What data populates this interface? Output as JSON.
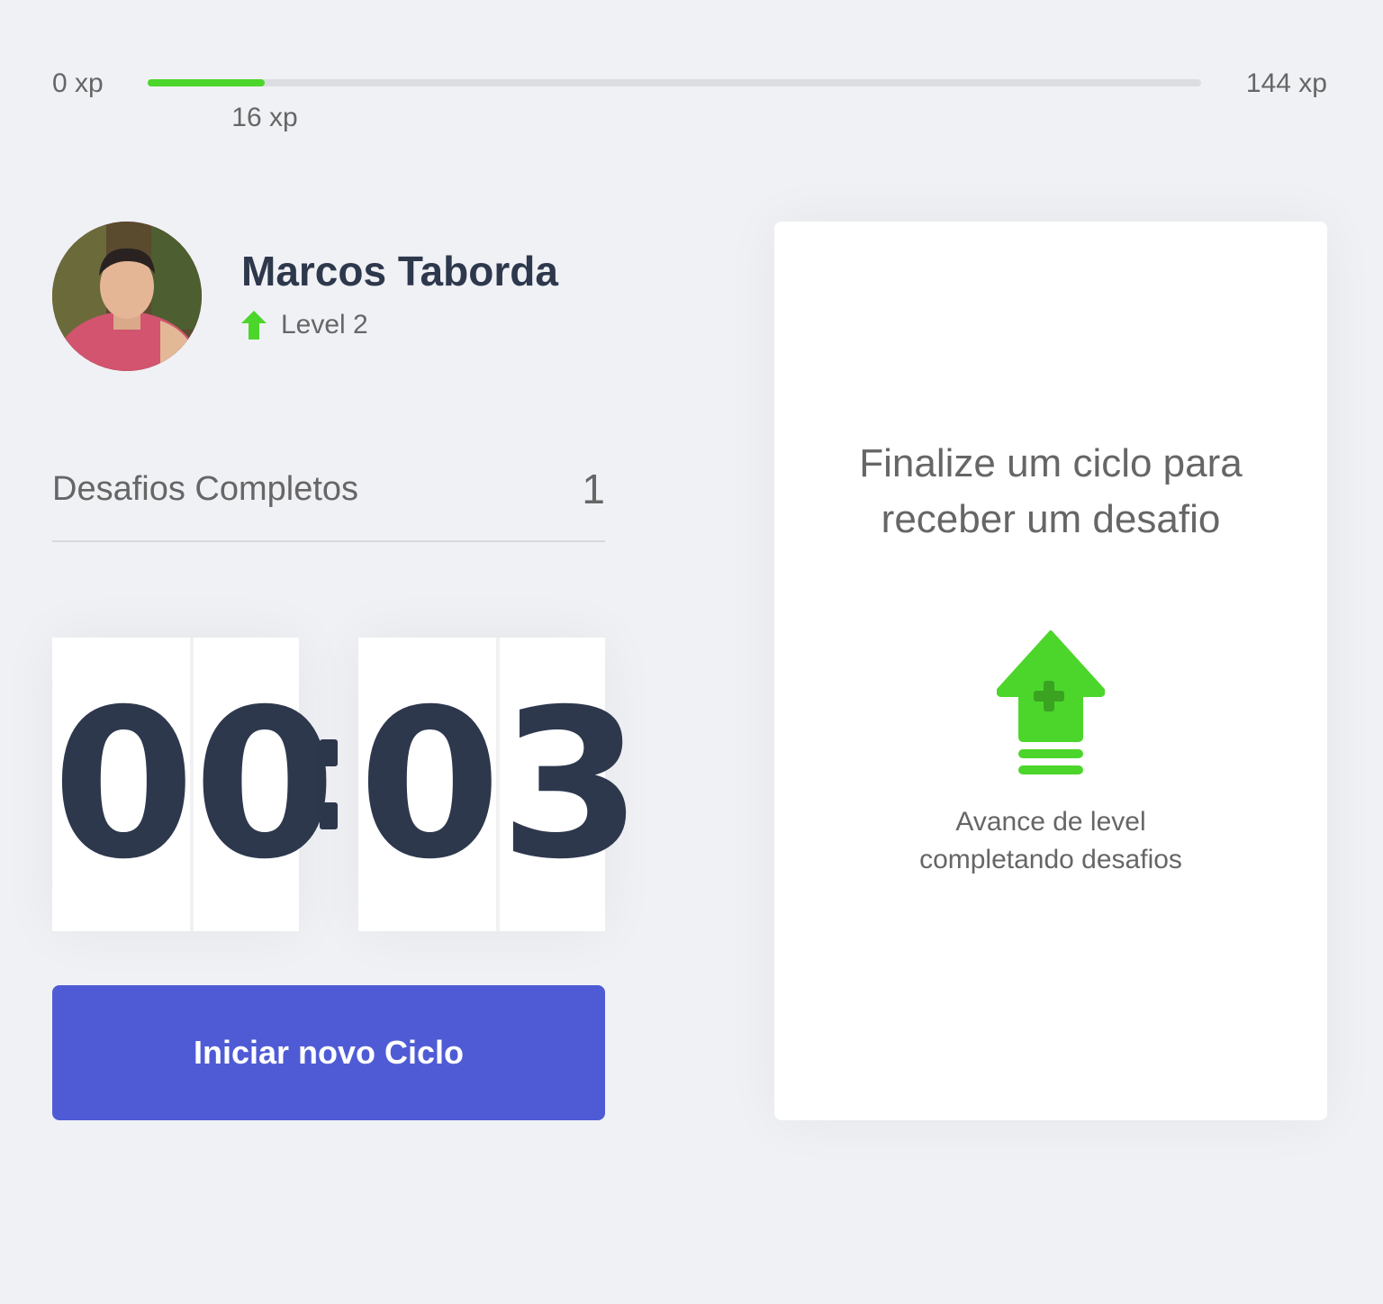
{
  "xp": {
    "min_label": "0 xp",
    "max_label": "144 xp",
    "current_label": "16 xp",
    "current_value": 16,
    "max_value": 144
  },
  "colors": {
    "accent_green": "#4cd62b",
    "button_blue": "#4f5bd5",
    "title_dark": "#2e384d",
    "text_gray": "#666666"
  },
  "profile": {
    "name": "Marcos Taborda",
    "level_label": "Level 2",
    "level_icon": "level-up-arrow-icon"
  },
  "challenges": {
    "label": "Desafios Completos",
    "count": "1"
  },
  "countdown": {
    "minute_left": "0",
    "minute_right": "0",
    "second_left": "0",
    "second_right": "3"
  },
  "start_button": {
    "label": "Iniciar novo Ciclo"
  },
  "challenge_card": {
    "title": "Finalize um ciclo para receber um desafio",
    "icon": "level-up-icon",
    "text": "Avance de level completando desafios"
  }
}
